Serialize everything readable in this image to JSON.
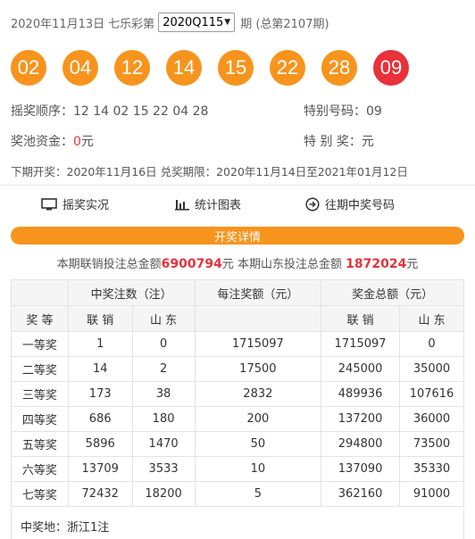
{
  "header": {
    "date": "2020年11月13日",
    "lottery": "七乐彩第",
    "issue_selected": "2020Q115",
    "suffix": "期 (总第2107期)"
  },
  "balls": [
    {
      "num": "02",
      "special": false
    },
    {
      "num": "04",
      "special": false
    },
    {
      "num": "12",
      "special": false
    },
    {
      "num": "14",
      "special": false
    },
    {
      "num": "15",
      "special": false
    },
    {
      "num": "22",
      "special": false
    },
    {
      "num": "28",
      "special": false
    },
    {
      "num": "09",
      "special": true
    }
  ],
  "info": {
    "order_label": "摇奖顺序：",
    "order_value": "12 14 02 15 22 04 28",
    "special_label": "特别号码：",
    "special_value": "09",
    "pool_label": "奖池资金：",
    "pool_value": "0",
    "pool_unit": "元",
    "special_prize_label": "特 别 奖：",
    "special_prize_unit": "元",
    "next_draw": "下期开奖：2020年11月16日 兑奖期限：2020年11月14日至2021年01月12日"
  },
  "links": {
    "live": "摇奖实况",
    "chart": "统计图表",
    "history": "往期中奖号码"
  },
  "bar_label": "开奖详情",
  "sales": {
    "part1": "本期联销投注总金额",
    "total": "6900794",
    "part2": "元 本期山东投注总金额",
    "shandong": "1872024",
    "part3": "元"
  },
  "table": {
    "h_count": "中奖注数（注）",
    "h_per": "每注奖额（元）",
    "h_total": "奖金总额（元）",
    "h_level": "奖 等",
    "h_lx": "联 销",
    "h_sd": "山 东",
    "h_lx2": "联 销",
    "h_sd2": "山 东",
    "rows": [
      {
        "level": "一等奖",
        "lx": "1",
        "sd": "0",
        "per": "1715097",
        "tlx": "1715097",
        "tsd": "0"
      },
      {
        "level": "二等奖",
        "lx": "14",
        "sd": "2",
        "per": "17500",
        "tlx": "245000",
        "tsd": "35000"
      },
      {
        "level": "三等奖",
        "lx": "173",
        "sd": "38",
        "per": "2832",
        "tlx": "489936",
        "tsd": "107616"
      },
      {
        "level": "四等奖",
        "lx": "686",
        "sd": "180",
        "per": "200",
        "tlx": "137200",
        "tsd": "36000"
      },
      {
        "level": "五等奖",
        "lx": "5896",
        "sd": "1470",
        "per": "50",
        "tlx": "294800",
        "tsd": "73500"
      },
      {
        "level": "六等奖",
        "lx": "13709",
        "sd": "3533",
        "per": "10",
        "tlx": "137090",
        "tsd": "35330"
      },
      {
        "level": "七等奖",
        "lx": "72432",
        "sd": "18200",
        "per": "5",
        "tlx": "362160",
        "tsd": "91000"
      }
    ]
  },
  "place": "中奖地：浙江1注",
  "colors": {
    "orange": "#f7941d",
    "red": "#e8313a"
  }
}
